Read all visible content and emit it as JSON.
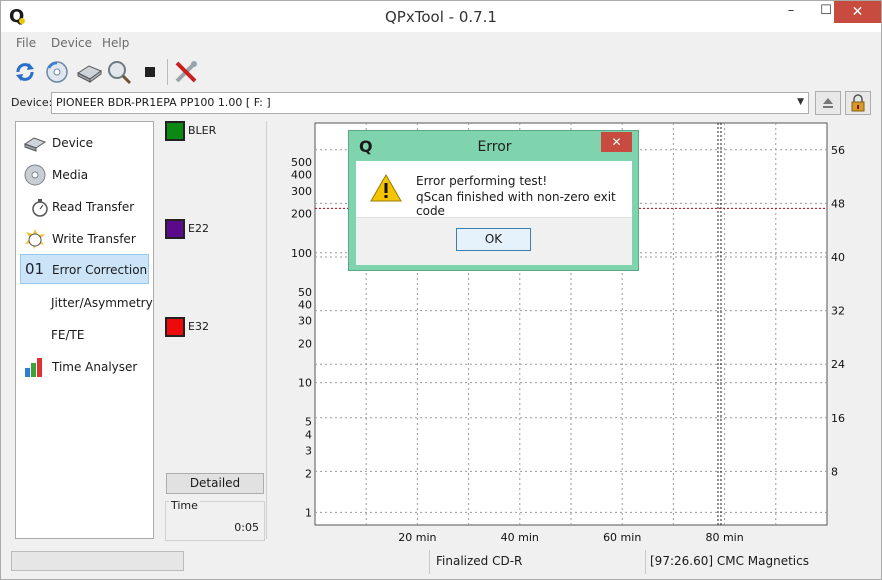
{
  "window": {
    "title": "QPxTool - 0.7.1",
    "app_icon_letter": "Q"
  },
  "titlebar_buttons": {
    "minimize": "–",
    "maximize": "☐",
    "close": "✕"
  },
  "menu": [
    "File",
    "Device",
    "Help"
  ],
  "toolbar": {
    "icons": [
      "refresh-icon",
      "device-info-icon",
      "drive-icon",
      "media-search-icon",
      "stop-icon",
      "tools-icon"
    ]
  },
  "device": {
    "label": "Device:",
    "value": "PIONEER  BDR-PR1EPA PP100 1.00 [ F: ]"
  },
  "nav": {
    "items": [
      {
        "label": "Device",
        "icon": "drive-icon"
      },
      {
        "label": "Media",
        "icon": "disc-icon"
      },
      {
        "label": "Read Transfer",
        "icon": "stopwatch-icon"
      },
      {
        "label": "Write Transfer",
        "icon": "stopwatch-burst-icon"
      },
      {
        "label": "Error Correction",
        "icon": "binary-icon",
        "prefix": "01",
        "active": true
      },
      {
        "label": "Jitter/Asymmetry",
        "icon": "none"
      },
      {
        "label": "FE/TE",
        "icon": "none"
      },
      {
        "label": "Time Analyser",
        "icon": "bar-chart-icon"
      }
    ]
  },
  "legend": {
    "items": [
      {
        "label": "BLER",
        "color": "#0a8a12"
      },
      {
        "label": "E22",
        "color": "#5a0a8a"
      },
      {
        "label": "E32",
        "color": "#ee0a0a"
      }
    ],
    "detailed_label": "Detailed",
    "time_label": "Time",
    "time_value": "0:05"
  },
  "chart_data": {
    "type": "line",
    "x_ticks": [
      20,
      40,
      60,
      80
    ],
    "x_tick_labels": [
      "20 min",
      "40 min",
      "60 min",
      "80 min"
    ],
    "xlim": [
      0,
      100
    ],
    "left_axis": {
      "scale": "log",
      "ticks": [
        1,
        2,
        3,
        4,
        5,
        10,
        20,
        30,
        40,
        50,
        100,
        200,
        300,
        400,
        500
      ],
      "ylim": [
        0.8,
        1000
      ]
    },
    "right_axis": {
      "ticks": [
        8,
        16,
        24,
        32,
        40,
        48,
        56
      ],
      "ylim": [
        0,
        60
      ]
    },
    "threshold_line": {
      "value": 220,
      "color": "#c00000"
    },
    "marker_line_x": 79,
    "grid": true,
    "series": []
  },
  "status": {
    "media": "Finalized CD-R",
    "disc_id": "[97:26.60] CMC Magnetics"
  },
  "dialog": {
    "title": "Error",
    "line1": "Error performing test!",
    "line2": "qScan finished with non-zero exit code",
    "ok_label": "OK",
    "close": "✕",
    "icon_letter": "Q"
  }
}
